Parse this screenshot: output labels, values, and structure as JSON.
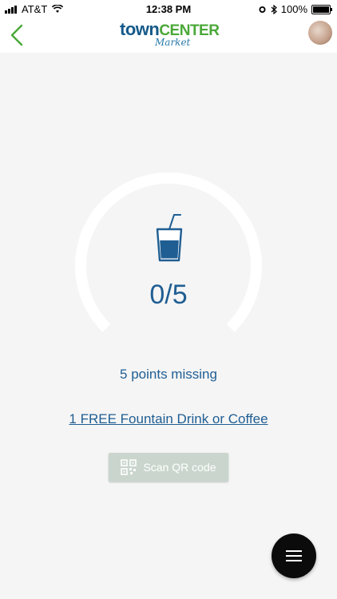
{
  "status_bar": {
    "carrier": "AT&T",
    "time": "12:38 PM",
    "battery": "100%",
    "icons": [
      "signal-icon",
      "wifi-icon",
      "alarm-icon",
      "bluetooth-icon",
      "battery-icon"
    ]
  },
  "header": {
    "logo": {
      "word1": "town",
      "word2": "CENTER",
      "word3": "Market"
    },
    "back_icon": "chevron-left-icon",
    "colors": {
      "back": "#4aa838",
      "logo_town": "#155a8a",
      "logo_center": "#4aa838"
    }
  },
  "reward": {
    "icon": "drink-cup-icon",
    "score": "0/5",
    "progress": 0,
    "missing_text": "5 points missing",
    "reward_text": "1 FREE Fountain Drink or Coffee",
    "scan_button": "Scan QR code",
    "accent_color": "#1f5e93"
  },
  "fab": {
    "icon": "menu-icon"
  }
}
